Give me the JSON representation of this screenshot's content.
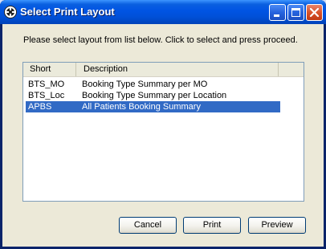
{
  "window": {
    "title": "Select Print Layout"
  },
  "dialog": {
    "instruction": "Please select layout from list below. Click to select and press proceed."
  },
  "listview": {
    "columns": [
      "Short",
      "Description"
    ],
    "rows": [
      {
        "short": "BTS_MO",
        "description": "Booking Type Summary per MO",
        "selected": false
      },
      {
        "short": "BTS_Loc",
        "description": "Booking Type Summary per Location",
        "selected": false
      },
      {
        "short": "APBS",
        "description": "All Patients Booking Summary",
        "selected": true
      }
    ]
  },
  "buttons": {
    "cancel": "Cancel",
    "print": "Print",
    "preview": "Preview"
  },
  "colors": {
    "titlebar": "#0054e3",
    "selection": "#316ac5",
    "dialog_bg": "#ece9d8"
  },
  "icons": {
    "app": "print-layout-app-icon",
    "minimize": "minimize-icon",
    "maximize": "maximize-icon",
    "close": "close-icon"
  }
}
